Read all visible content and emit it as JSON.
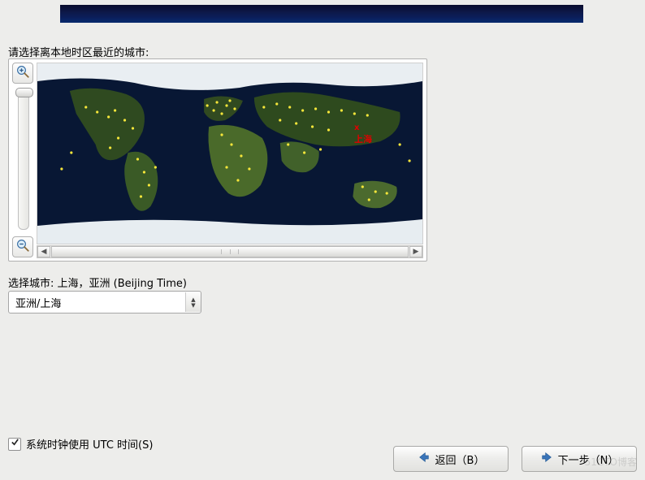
{
  "prompt": "请选择离本地时区最近的城市:",
  "map": {
    "selected_city_label": "上海",
    "selected_marker": "x"
  },
  "selected_city_line_prefix": "选择城市: ",
  "selected_city_line_value": "上海，亚洲 (Beijing Time)",
  "timezone_combo": {
    "value": "亚洲/上海"
  },
  "utc_checkbox": {
    "label": "系统时钟使用 UTC 时间(S)",
    "checked": true
  },
  "nav": {
    "back": "返回（B）",
    "next": "下一步（N）"
  },
  "watermark": "51CTO博客"
}
